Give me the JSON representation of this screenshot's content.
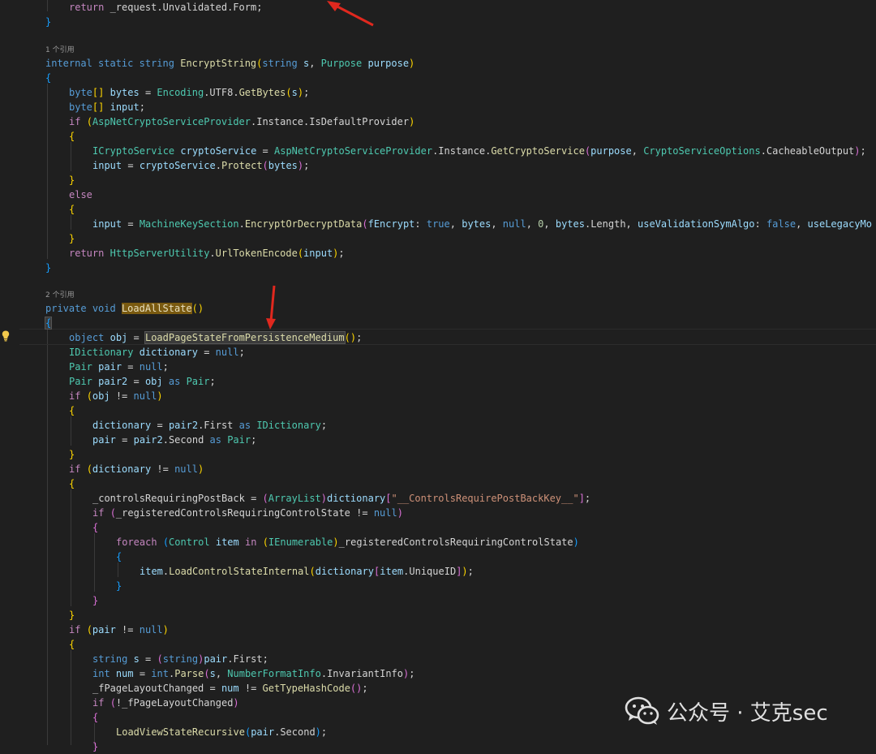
{
  "codelens": {
    "ref1": "1 个引用",
    "ref2": "2 个引用"
  },
  "code": {
    "l_return_form": "return _request.Unvalidated.Form;",
    "sig_encrypt": "internal static string EncryptString(string s, Purpose purpose)",
    "l_bytes": "byte[] bytes = Encoding.UTF8.GetBytes(s);",
    "l_input_decl": "byte[] input;",
    "l_if_default": "if (AspNetCryptoServiceProvider.Instance.IsDefaultProvider)",
    "l_crypto_service": "ICryptoService cryptoService = AspNetCryptoServiceProvider.Instance.GetCryptoService(purpose, CryptoServiceOptions.CacheableOutput);",
    "l_protect": "input = cryptoService.Protect(bytes);",
    "l_else": "else",
    "l_machinekey": "input = MachineKeySection.EncryptOrDecryptData(fEncrypt: true, bytes, null, 0, bytes.Length, useValidationSymAlgo: false, useLegacyMo",
    "l_return_encode": "return HttpServerUtility.UrlTokenEncode(input);",
    "sig_loadall": "private void LoadAllState()",
    "l_object_obj": "object obj = LoadPageStateFromPersistenceMedium();",
    "l_idictionary": "IDictionary dictionary = null;",
    "l_pair": "Pair pair = null;",
    "l_pair2": "Pair pair2 = obj as Pair;",
    "l_if_obj": "if (obj != null)",
    "l_dict_first": "dictionary = pair2.First as IDictionary;",
    "l_pair_second": "pair = pair2.Second as Pair;",
    "l_if_dict": "if (dictionary != null)",
    "l_controls": "_controlsRequiringPostBack = (ArrayList)dictionary[\"__ControlsRequirePostBackKey__\"];",
    "l_if_registered": "if (_registeredControlsRequiringControlState != null)",
    "l_foreach": "foreach (Control item in (IEnumerable)_registeredControlsRequiringControlState)",
    "l_loadcontrol": "item.LoadControlStateInternal(dictionary[item.UniqueID]);",
    "l_if_pair": "if (pair != null)",
    "l_string_s": "string s = (string)pair.First;",
    "l_int_num": "int num = int.Parse(s, NumberFormatInfo.InvariantInfo);",
    "l_fpage": "_fPageLayoutChanged = num != GetTypeHashCode();",
    "l_if_not_fpage": "if (!_fPageLayoutChanged)",
    "l_loadview": "LoadViewStateRecursive(pair.Second);"
  },
  "watermark": {
    "text": "公众号 · 艾克sec",
    "icon": "wechat-icon"
  },
  "icons": [
    "lightbulb-icon",
    "red-arrow-icon",
    "wechat-icon"
  ],
  "colors": {
    "background": "#1f1f1f",
    "keyword": "#569cd6",
    "control": "#c586c0",
    "function": "#dcdcaa",
    "type": "#4ec9b0",
    "string": "#ce9178",
    "highlight": "#7a5a10",
    "arrow": "#e0281e"
  }
}
